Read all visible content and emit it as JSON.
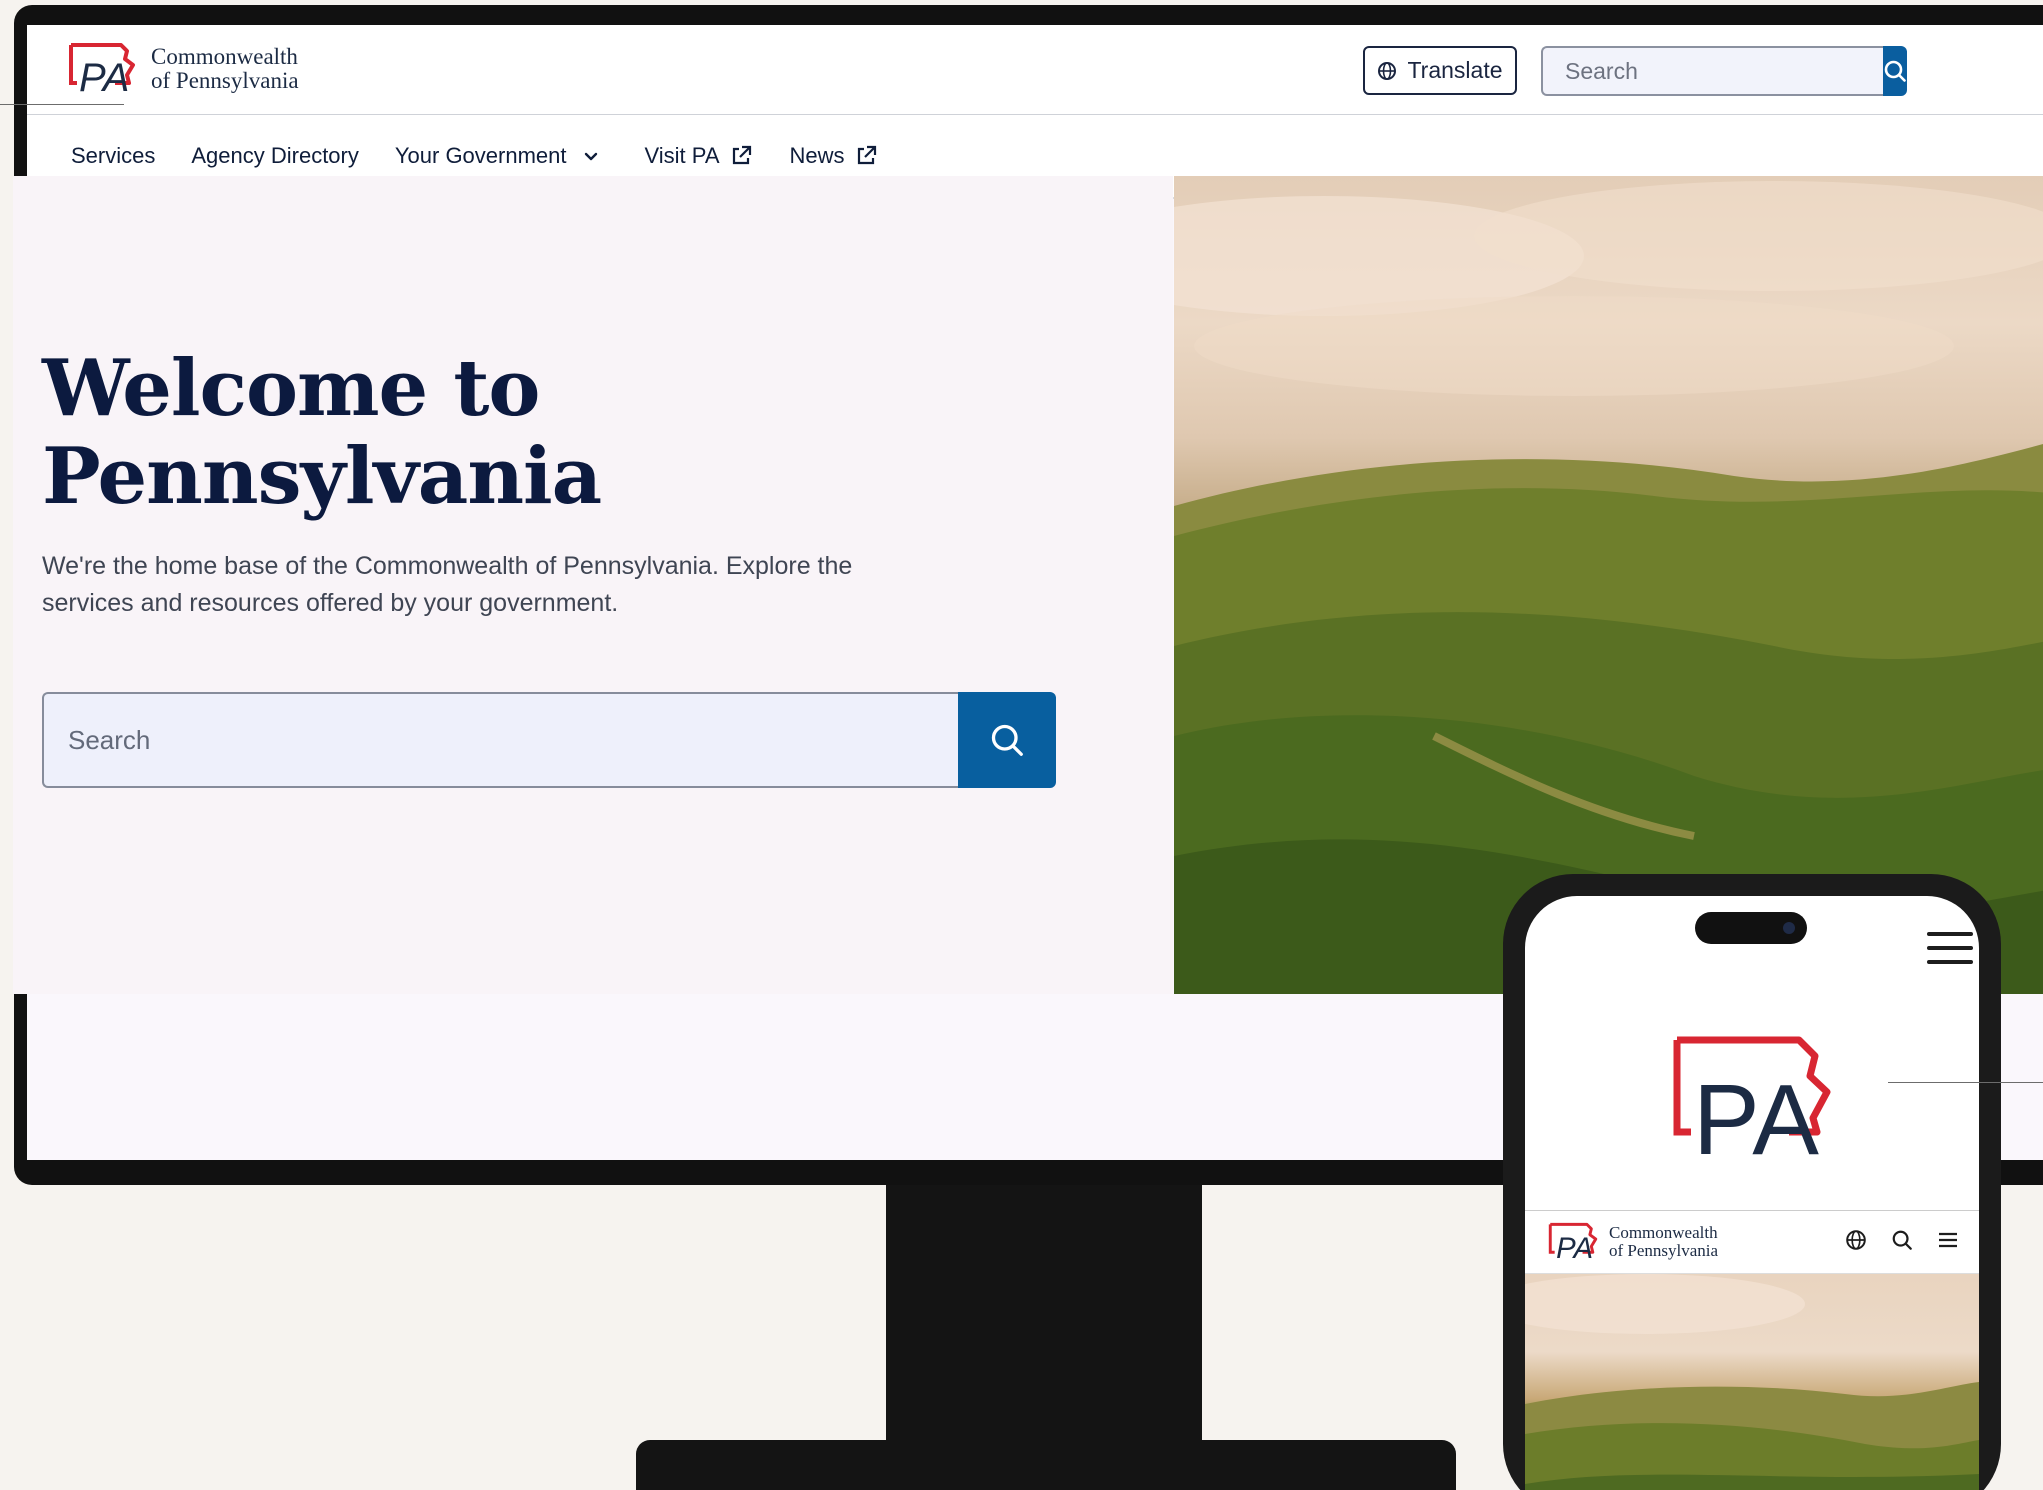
{
  "header": {
    "logo_line1": "Commonwealth",
    "logo_line2": "of Pennsylvania",
    "logo_mark": "PA",
    "translate_label": "Translate",
    "search_placeholder": "Search"
  },
  "nav": {
    "items": [
      {
        "label": "Services"
      },
      {
        "label": "Agency Directory"
      },
      {
        "label": "Your Government"
      },
      {
        "label": "Visit PA"
      },
      {
        "label": "News"
      }
    ]
  },
  "hero": {
    "title_line1": "Welcome to",
    "title_line2": "Pennsylvania",
    "subtitle": "We're the home base of the Commonwealth of Pennsylvania. Explore the services and resources offered by your government.",
    "search_placeholder": "Search"
  },
  "phone": {
    "logo_mark": "PA",
    "logo_line1": "Commonwealth",
    "logo_line2": "of Pennsylvania"
  },
  "colors": {
    "brand_navy": "#0c1a3f",
    "brand_blue": "#085f9f",
    "brand_red": "#d82632"
  },
  "icons": {
    "translate": "globe-icon",
    "search": "search-icon",
    "dropdown": "chevron-down-icon",
    "external": "external-link-icon",
    "menu": "hamburger-icon"
  }
}
